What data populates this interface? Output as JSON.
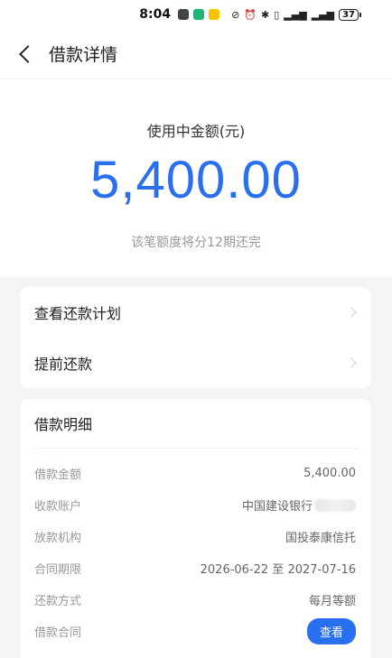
{
  "status_bar": {
    "time": "8:04",
    "battery": "37"
  },
  "nav": {
    "title": "借款详情"
  },
  "hero": {
    "label": "使用中金额(元)",
    "amount": "5,400.00",
    "note": "该笔额度将分12期还完"
  },
  "actions": [
    {
      "label": "查看还款计划"
    },
    {
      "label": "提前还款"
    }
  ],
  "details": {
    "title": "借款明细",
    "rows": [
      {
        "label": "借款金额",
        "value": "5,400.00"
      },
      {
        "label": "收款账户",
        "value": "中国建设银行"
      },
      {
        "label": "放款机构",
        "value": "国投泰康信托"
      },
      {
        "label": "合同期限",
        "value": "2026-06-22 至 2027-07-16"
      },
      {
        "label": "还款方式",
        "value": "每月等额"
      },
      {
        "label": "借款合同",
        "button": "查看"
      }
    ]
  },
  "colors": {
    "accent": "#2a6ff0",
    "background": "#f3f4f6"
  }
}
